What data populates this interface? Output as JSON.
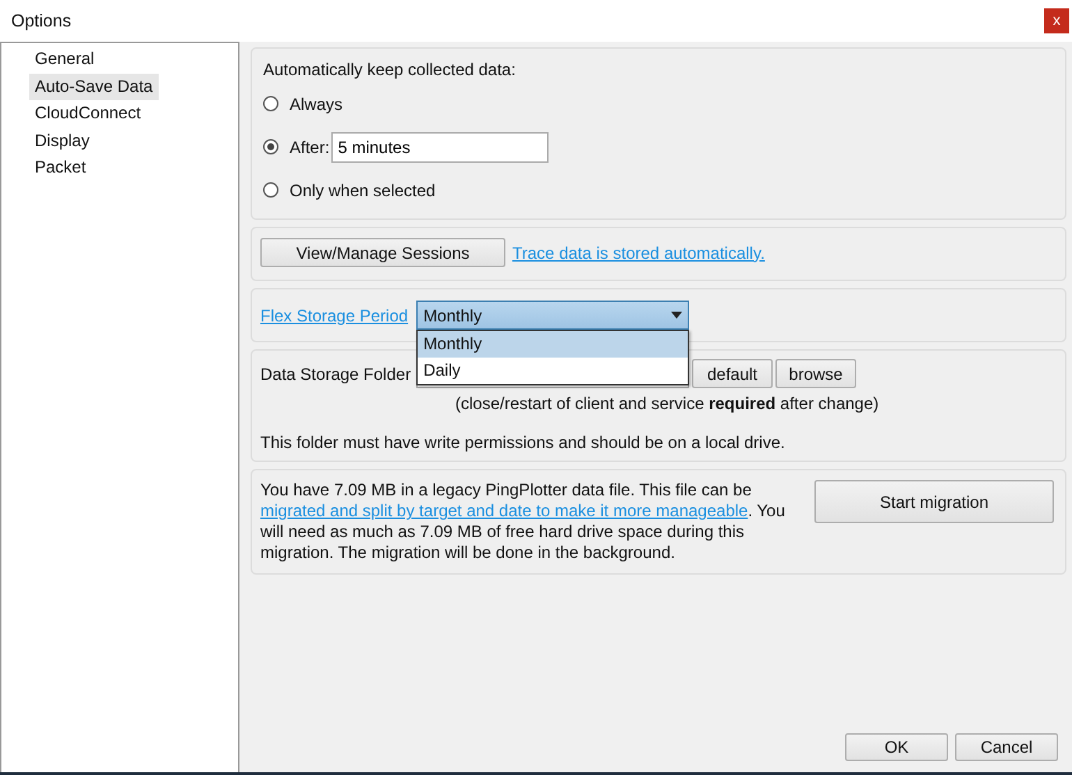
{
  "window": {
    "title": "Options",
    "close": "x"
  },
  "sidebar": {
    "items": [
      {
        "label": "General",
        "selected": false
      },
      {
        "label": "Auto-Save Data",
        "selected": true
      },
      {
        "label": "CloudConnect",
        "selected": false
      },
      {
        "label": "Display",
        "selected": false
      },
      {
        "label": "Packet",
        "selected": false
      }
    ]
  },
  "autosave": {
    "heading": "Automatically keep collected data:",
    "options": [
      {
        "label": "Always",
        "selected": false
      },
      {
        "label": "After:",
        "selected": true,
        "value": "5 minutes"
      },
      {
        "label": "Only when selected",
        "selected": false
      }
    ]
  },
  "sessions": {
    "button": "View/Manage Sessions",
    "link": "Trace data is stored automatically."
  },
  "flex": {
    "link": "Flex Storage Period",
    "value": "Monthly",
    "expanded": true,
    "options": [
      {
        "label": "Monthly",
        "selected": true
      },
      {
        "label": "Daily",
        "selected": false
      }
    ]
  },
  "storage": {
    "label": "Data Storage Folder",
    "default_button": "default",
    "browse_button": "browse",
    "note_before": "(close/restart of client and service ",
    "note_bold": "required",
    "note_after": " after change)",
    "info": "This folder must have write permissions and should be on a local drive."
  },
  "migration": {
    "text_before": "You have 7.09 MB in a legacy PingPlotter data file. This file can be ",
    "link": "migrated and split by target and date to make it more manageable",
    "text_after": ". You will need as much as 7.09 MB of free hard drive space during this migration. The migration will be done in the background.",
    "button": "Start migration"
  },
  "buttons": [
    {
      "label": "OK"
    },
    {
      "label": "Cancel"
    }
  ]
}
